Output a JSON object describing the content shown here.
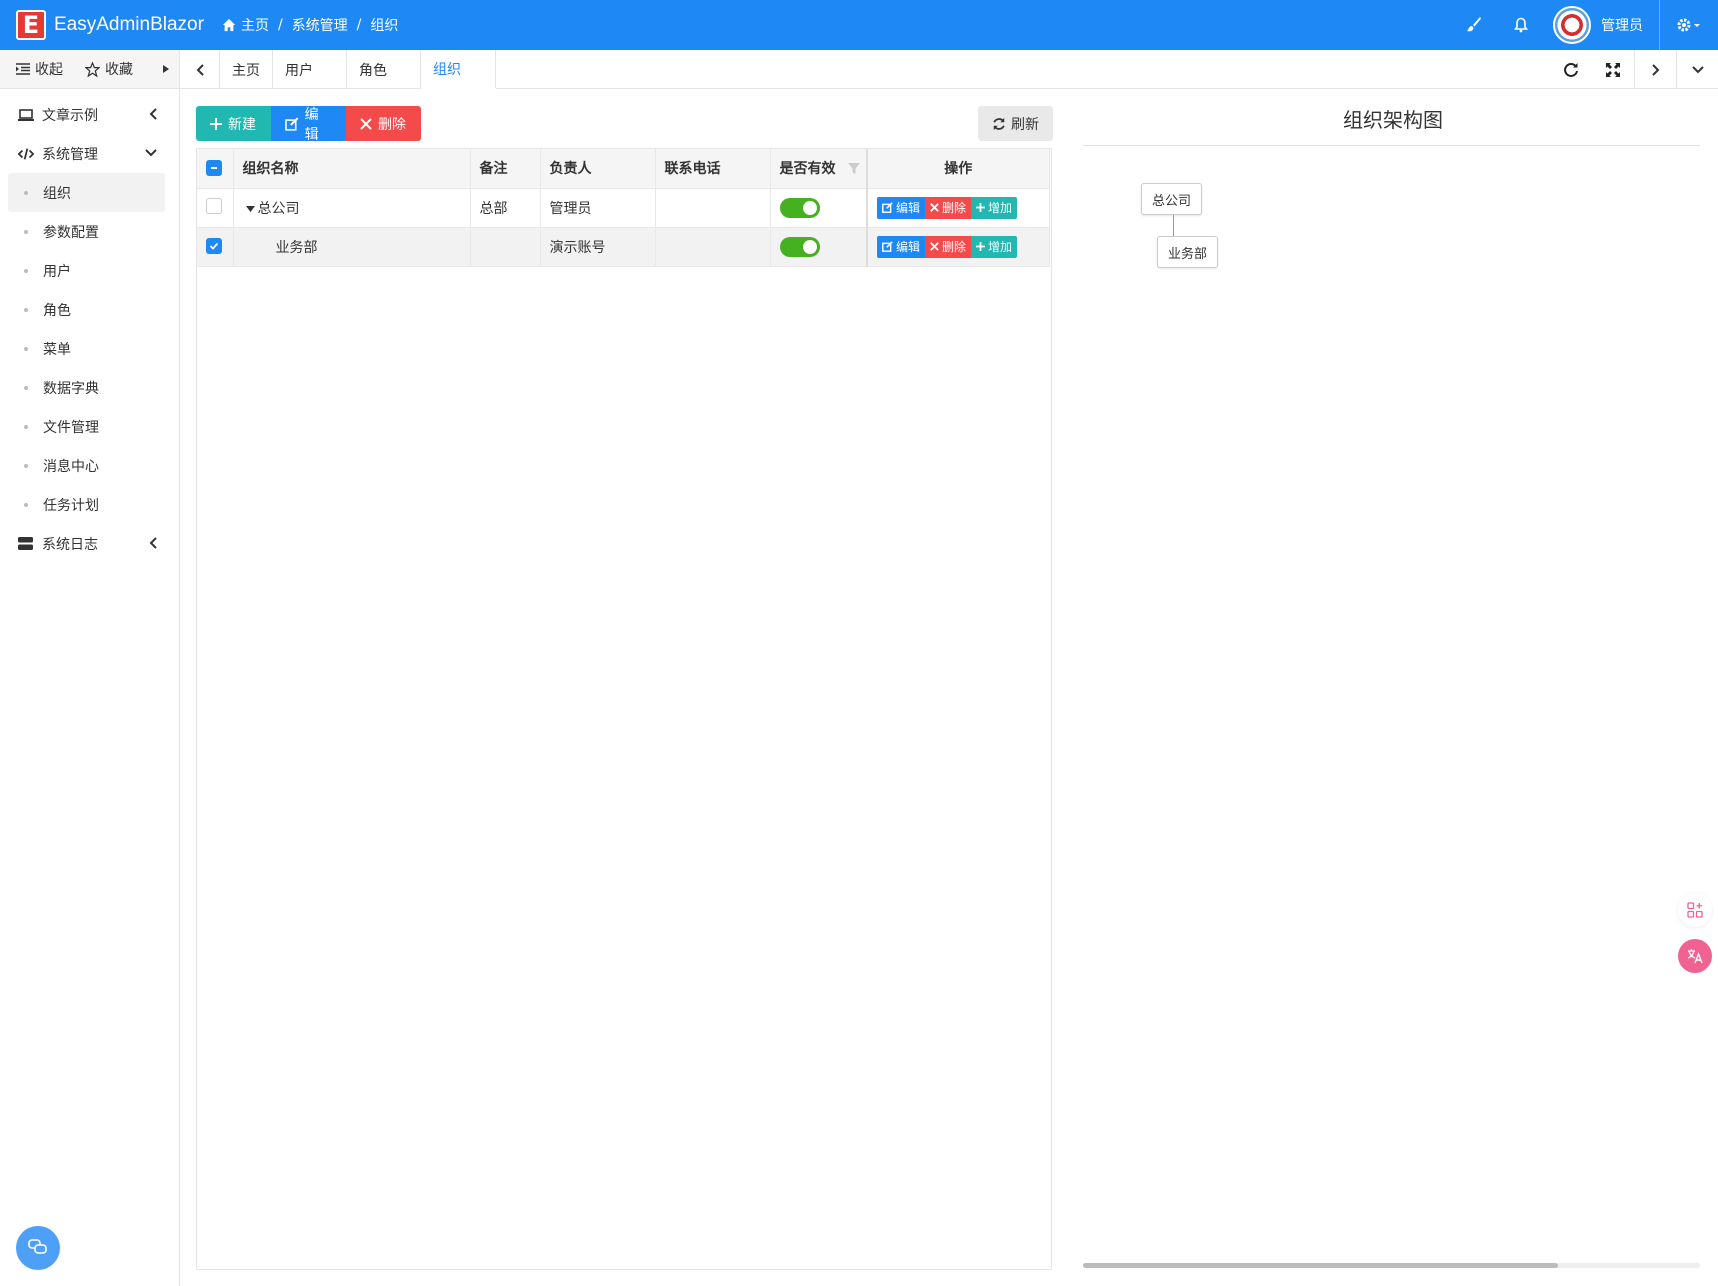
{
  "header": {
    "logo_letter": "E",
    "app_title": "EasyAdminBlazor",
    "breadcrumb": [
      "主页",
      "系统管理",
      "组织"
    ],
    "breadcrumb_sep": "/",
    "user_name": "管理员",
    "bg_color": "#1e88f5"
  },
  "sidebar": {
    "collapse_label": "收起",
    "favorite_label": "收藏",
    "menu": [
      {
        "label": "文章示例",
        "icon": "laptop-icon"
      },
      {
        "label": "系统管理",
        "icon": "code-icon"
      },
      {
        "label": "系统日志",
        "icon": "server-icon"
      }
    ],
    "submenu": [
      "组织",
      "参数配置",
      "用户",
      "角色",
      "菜单",
      "数据字典",
      "文件管理",
      "消息中心",
      "任务计划"
    ],
    "active_submenu": "组织"
  },
  "tabs": [
    "主页",
    "用户",
    "角色",
    "组织"
  ],
  "active_tab": "组织",
  "toolbar": {
    "new_label": "新建",
    "edit_label": "编辑",
    "delete_label": "删除",
    "refresh_label": "刷新"
  },
  "table": {
    "columns": [
      "组织名称",
      "备注",
      "负责人",
      "联系电话",
      "是否有效",
      "操作"
    ],
    "rows": [
      {
        "name": "总公司",
        "note": "总部",
        "owner": "管理员",
        "phone": "",
        "active": true,
        "checked": false,
        "expanded": true
      },
      {
        "name": "业务部",
        "note": "",
        "owner": "演示账号",
        "phone": "",
        "active": true,
        "checked": true
      }
    ],
    "row_actions": {
      "edit": "编辑",
      "delete": "删除",
      "add": "增加"
    }
  },
  "org_chart": {
    "title": "组织架构图",
    "root": "总公司",
    "child": "业务部"
  },
  "colors": {
    "primary": "#1e88f5",
    "success": "#20b8b0",
    "danger": "#f44a4a",
    "switch_on": "#45b020"
  }
}
